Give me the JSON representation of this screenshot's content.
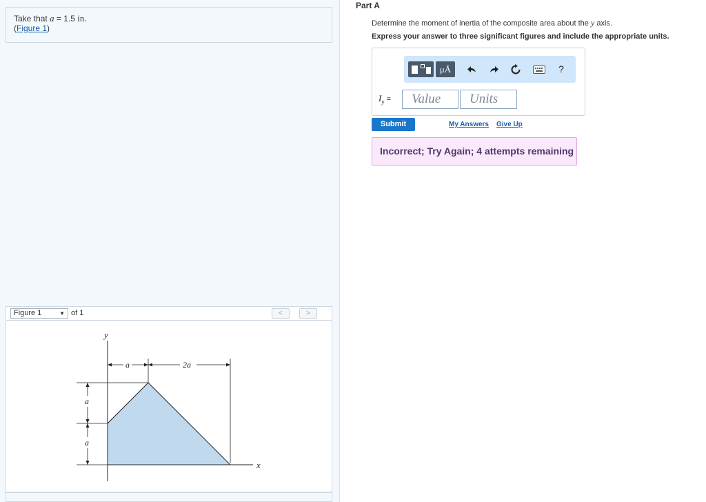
{
  "problem": {
    "take_that": "Take that",
    "variable": "a",
    "equals": "=",
    "value": "1.5",
    "unit": "in.",
    "figure_link": "Figure 1",
    "open_paren": "(",
    "close_paren": ")"
  },
  "figure_nav": {
    "selected": "Figure 1",
    "of_text": "of 1",
    "prev": "<",
    "next": ">"
  },
  "figure_labels": {
    "y_axis": "y",
    "x_axis": "x",
    "top_a": "a",
    "top_2a": "2a",
    "left_a_upper": "a",
    "left_a_lower": "a"
  },
  "part": {
    "title": "Part A",
    "question_prefix": "Determine the moment of inertia of the composite area about the",
    "question_var": "y",
    "question_suffix": "axis.",
    "instruction": "Express your answer to three significant figures and include the appropriate units."
  },
  "toolbar": {
    "units_label": "μÅ",
    "undo_icon": "undo-icon",
    "redo_icon": "redo-icon",
    "reset_icon": "reset-icon",
    "keyboard_icon": "keyboard-icon",
    "help": "?"
  },
  "answer": {
    "label_main": "I",
    "label_sub": "y",
    "label_eq": "=",
    "value_placeholder": "Value",
    "units_placeholder": "Units"
  },
  "actions": {
    "submit": "Submit",
    "my_answers": "My Answers",
    "give_up": "Give Up"
  },
  "feedback": {
    "message": "Incorrect; Try Again; 4 attempts remaining"
  },
  "colors": {
    "accent": "#1977c9",
    "toolbar_bg": "#cfe6fb",
    "feedback_bg": "#fbe8fb",
    "shape_fill": "#c0d9ee"
  }
}
